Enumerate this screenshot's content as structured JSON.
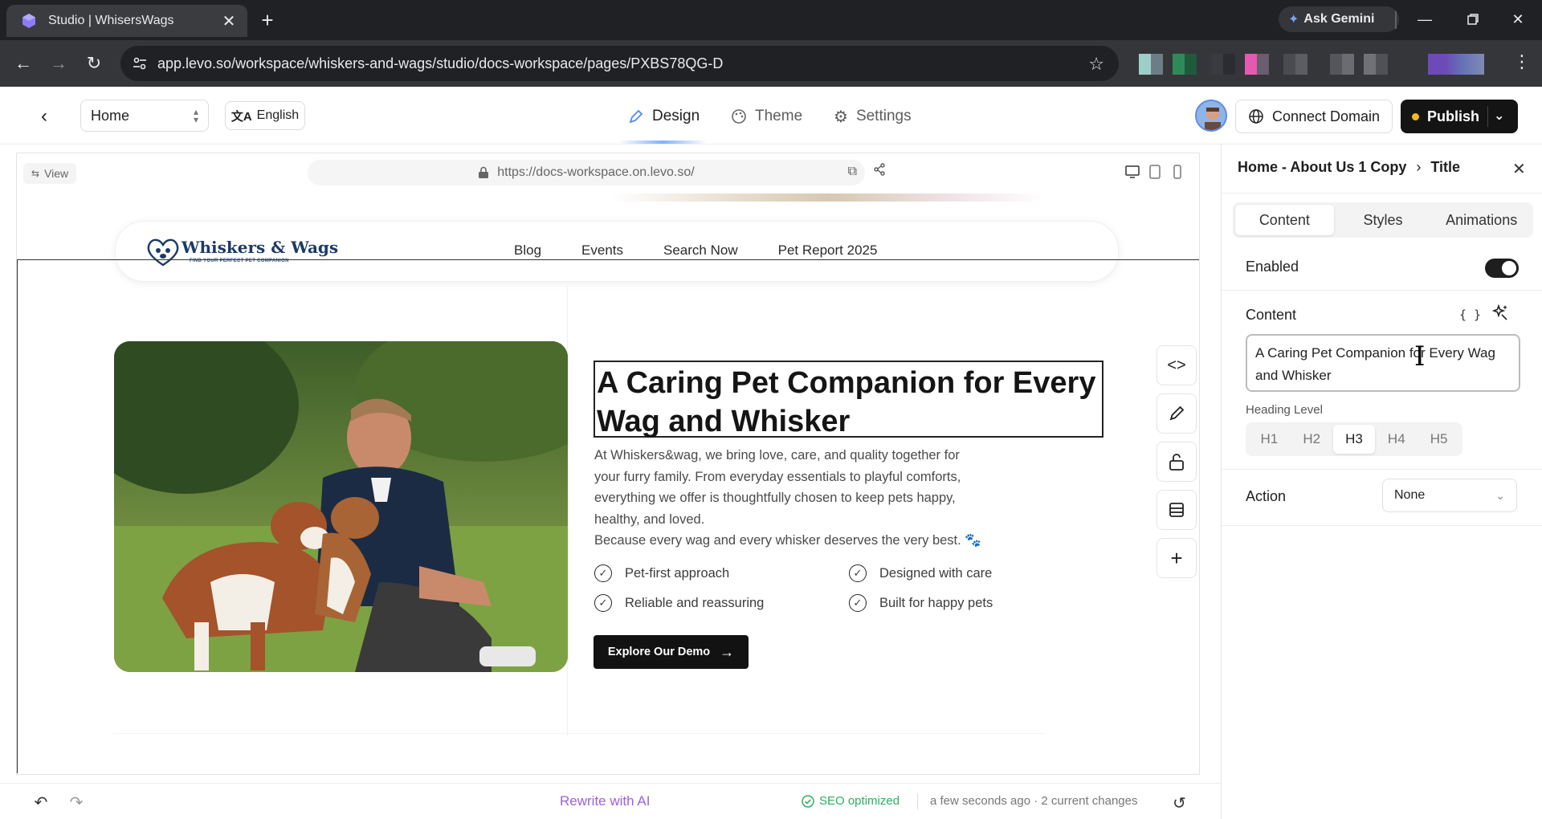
{
  "browser": {
    "tab_title": "Studio | WhisersWags",
    "url": "app.levo.so/workspace/whiskers-and-wags/studio/docs-workspace/pages/PXBS78QG-D",
    "gemini_label": "Ask Gemini",
    "new_tab": "+",
    "close": "✕"
  },
  "header": {
    "page_select": "Home",
    "language": "English",
    "tabs": [
      {
        "label": "Design"
      },
      {
        "label": "Theme"
      },
      {
        "label": "Settings"
      }
    ],
    "connect_domain": "Connect Domain",
    "publish": "Publish"
  },
  "canvas": {
    "view_label": "View",
    "preview_url": "https://docs-workspace.on.levo.so/",
    "site": {
      "brand": "Whiskers & Wags",
      "tagline": "FIND YOUR PERFECT PET COMPANION",
      "nav": [
        "Blog",
        "Events",
        "Search Now",
        "Pet Report 2025"
      ],
      "heading": "A Caring Pet Companion for Every Wag and Whisker",
      "paragraph_lines": [
        "At Whiskers&wag, we bring love, care, and quality together for",
        "your furry family. From everyday essentials to playful comforts,",
        "everything we offer is thoughtfully chosen to keep pets happy,",
        "healthy, and loved.",
        "Because every wag and every whisker deserves the very best. 🐾"
      ],
      "features": [
        "Pet-first approach",
        "Designed with care",
        "Reliable and reassuring",
        "Built for happy pets"
      ],
      "cta": "Explore Our Demo"
    }
  },
  "bottom_bar": {
    "rewrite": "Rewrite with AI",
    "seo": "SEO optimized",
    "status": "a few seconds ago · 2 current changes"
  },
  "panel": {
    "breadcrumb_parent": "Home - About Us 1 Copy",
    "breadcrumb_current": "Title",
    "tabs": [
      "Content",
      "Styles",
      "Animations"
    ],
    "enabled_label": "Enabled",
    "enabled": true,
    "content_label": "Content",
    "brace_label": "{ }",
    "content_text": "A Caring Pet Companion for Every Wag and Whisker",
    "heading_level_label": "Heading Level",
    "heading_levels": [
      "H1",
      "H2",
      "H3",
      "H4",
      "H5"
    ],
    "heading_level_selected": "H3",
    "action_label": "Action",
    "action_value": "None"
  },
  "colors": {
    "accent_purple": "#9b5fe0",
    "seo_green": "#2eaf5f",
    "publish_dot": "#f5b91a"
  }
}
